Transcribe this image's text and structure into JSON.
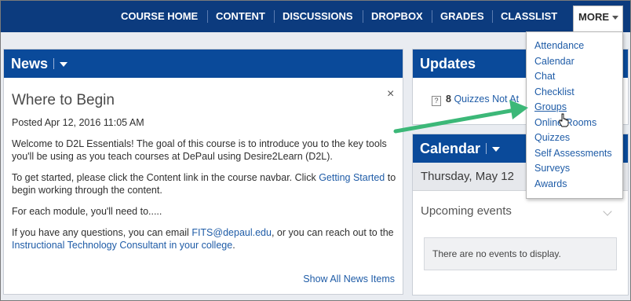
{
  "navbar": {
    "items": [
      "COURSE HOME",
      "CONTENT",
      "DISCUSSIONS",
      "DROPBOX",
      "GRADES",
      "CLASSLIST"
    ],
    "more_label": "MORE"
  },
  "more_menu": {
    "items": [
      "Attendance",
      "Calendar",
      "Chat",
      "Checklist",
      "Groups",
      "Online Rooms",
      "Quizzes",
      "Self Assessments",
      "Surveys",
      "Awards"
    ],
    "hovered": "Groups"
  },
  "news": {
    "header": "News",
    "title": "Where to Begin",
    "posted": "Posted Apr 12, 2016 11:05 AM",
    "close": "×",
    "p1": "Welcome to D2L Essentials! The goal of this course is to introduce you to the key tools you'll be using as you teach courses at DePaul using Desire2Learn (D2L).",
    "p2_before": "To get started, please click the Content link in the course navbar. Click ",
    "p2_link": "Getting Started",
    "p2_after": " to begin working through the content.",
    "p3": "For each module, you'll need to.....",
    "p4_before": "If you have any questions, you can email ",
    "p4_email": "FITS@depaul.edu",
    "p4_mid": ", or you can reach out to the ",
    "p4_link": "Instructional Technology Consultant in your college",
    "p4_end": ".",
    "show_all": "Show All News Items"
  },
  "updates": {
    "header": "Updates",
    "count": "8",
    "label": "Quizzes Not At"
  },
  "calendar": {
    "header": "Calendar",
    "day": "Thursday, May 12",
    "upcoming": "Upcoming events",
    "no_events": "There are no events to display."
  },
  "colors": {
    "navbar": "#0c3b7e",
    "widget_header": "#0a4a9a",
    "link": "#1f5ca7",
    "annotation_arrow": "#3cb878"
  }
}
